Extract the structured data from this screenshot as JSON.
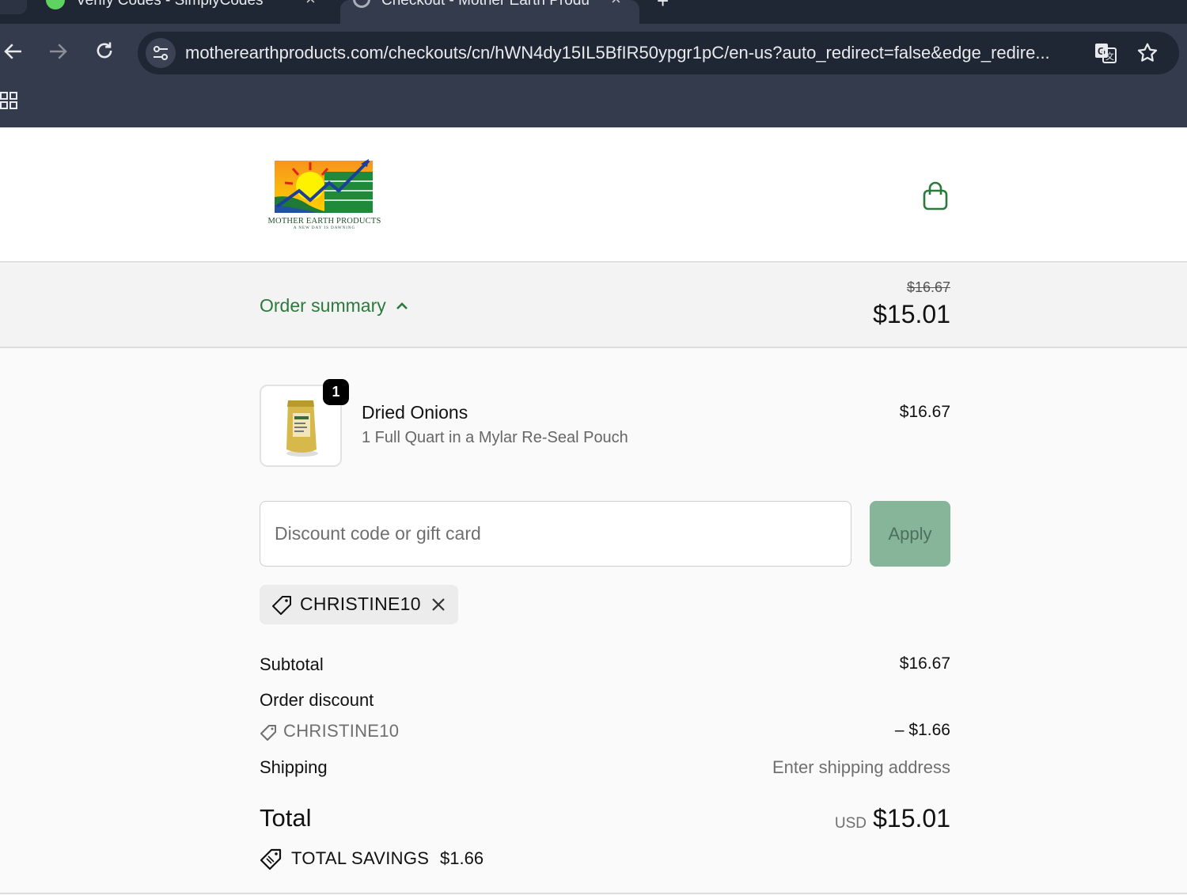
{
  "browser": {
    "tabs": [
      {
        "label": "Verify Codes - SimplyCodes",
        "close": "×"
      },
      {
        "label": "Checkout - Mother Earth Produ",
        "close": "×"
      }
    ],
    "new_tab": "+",
    "url": "motherearthproducts.com/checkouts/cn/hWN4dy15IL5BfIR50ypgr1pC/en-us?auto_redirect=false&edge_redire..."
  },
  "header": {
    "logo_text": "MOTHER EARTH PRODUCTS",
    "logo_tagline": "A NEW DAY IS DAWNING"
  },
  "summary": {
    "toggle_label": "Order summary",
    "original_total": "$16.67",
    "total": "$15.01"
  },
  "item": {
    "quantity": "1",
    "name": "Dried Onions",
    "variant": "1 Full Quart in a Mylar Re-Seal Pouch",
    "price": "$16.67"
  },
  "discount": {
    "placeholder": "Discount code or gift card",
    "apply_label": "Apply",
    "applied_code": "CHRISTINE10"
  },
  "totals": {
    "subtotal_label": "Subtotal",
    "subtotal_value": "$16.67",
    "order_discount_label": "Order discount",
    "discount_code": "CHRISTINE10",
    "discount_value": "– $1.66",
    "shipping_label": "Shipping",
    "shipping_value": "Enter shipping address",
    "total_label": "Total",
    "currency": "USD",
    "total_value": "$15.01",
    "savings_label": "TOTAL SAVINGS",
    "savings_value": "$1.66"
  },
  "colors": {
    "accent_green": "#2b7a3c",
    "apply_button": "#86b59a",
    "chrome_bg": "#333b4d"
  }
}
